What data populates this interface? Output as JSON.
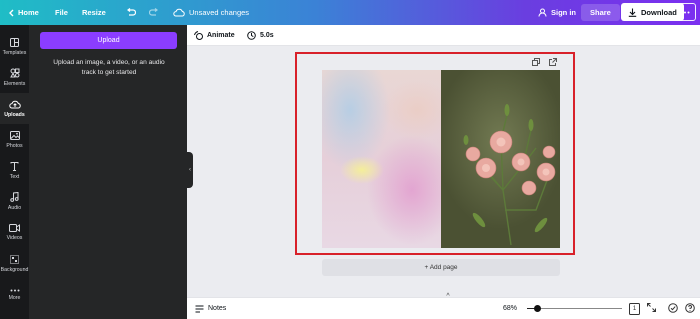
{
  "topbar": {
    "home": "Home",
    "file": "File",
    "resize": "Resize",
    "status": "Unsaved changes",
    "sign_in": "Sign in",
    "share": "Share",
    "download": "Download"
  },
  "rail": {
    "items": [
      {
        "label": "Templates",
        "icon": "templates-icon"
      },
      {
        "label": "Elements",
        "icon": "elements-icon"
      },
      {
        "label": "Uploads",
        "icon": "uploads-icon",
        "active": true
      },
      {
        "label": "Photos",
        "icon": "photos-icon"
      },
      {
        "label": "Text",
        "icon": "text-icon"
      },
      {
        "label": "Audio",
        "icon": "audio-icon"
      },
      {
        "label": "Videos",
        "icon": "videos-icon"
      },
      {
        "label": "Background",
        "icon": "background-icon"
      },
      {
        "label": "More",
        "icon": "more-icon"
      }
    ]
  },
  "panel": {
    "upload_label": "Upload",
    "hint": "Upload an image, a video, or an audio track to get started"
  },
  "toolbar": {
    "animate": "Animate",
    "duration": "5.0s"
  },
  "canvas": {
    "add_page": "+ Add page"
  },
  "bottombar": {
    "notes": "Notes",
    "zoom": "68%",
    "zoom_level": 0.68,
    "page_count": "1"
  },
  "colors": {
    "brand": "#8b3dff",
    "selection": "#d8212a",
    "rail_bg": "#18191b",
    "panel_bg": "#252627"
  }
}
